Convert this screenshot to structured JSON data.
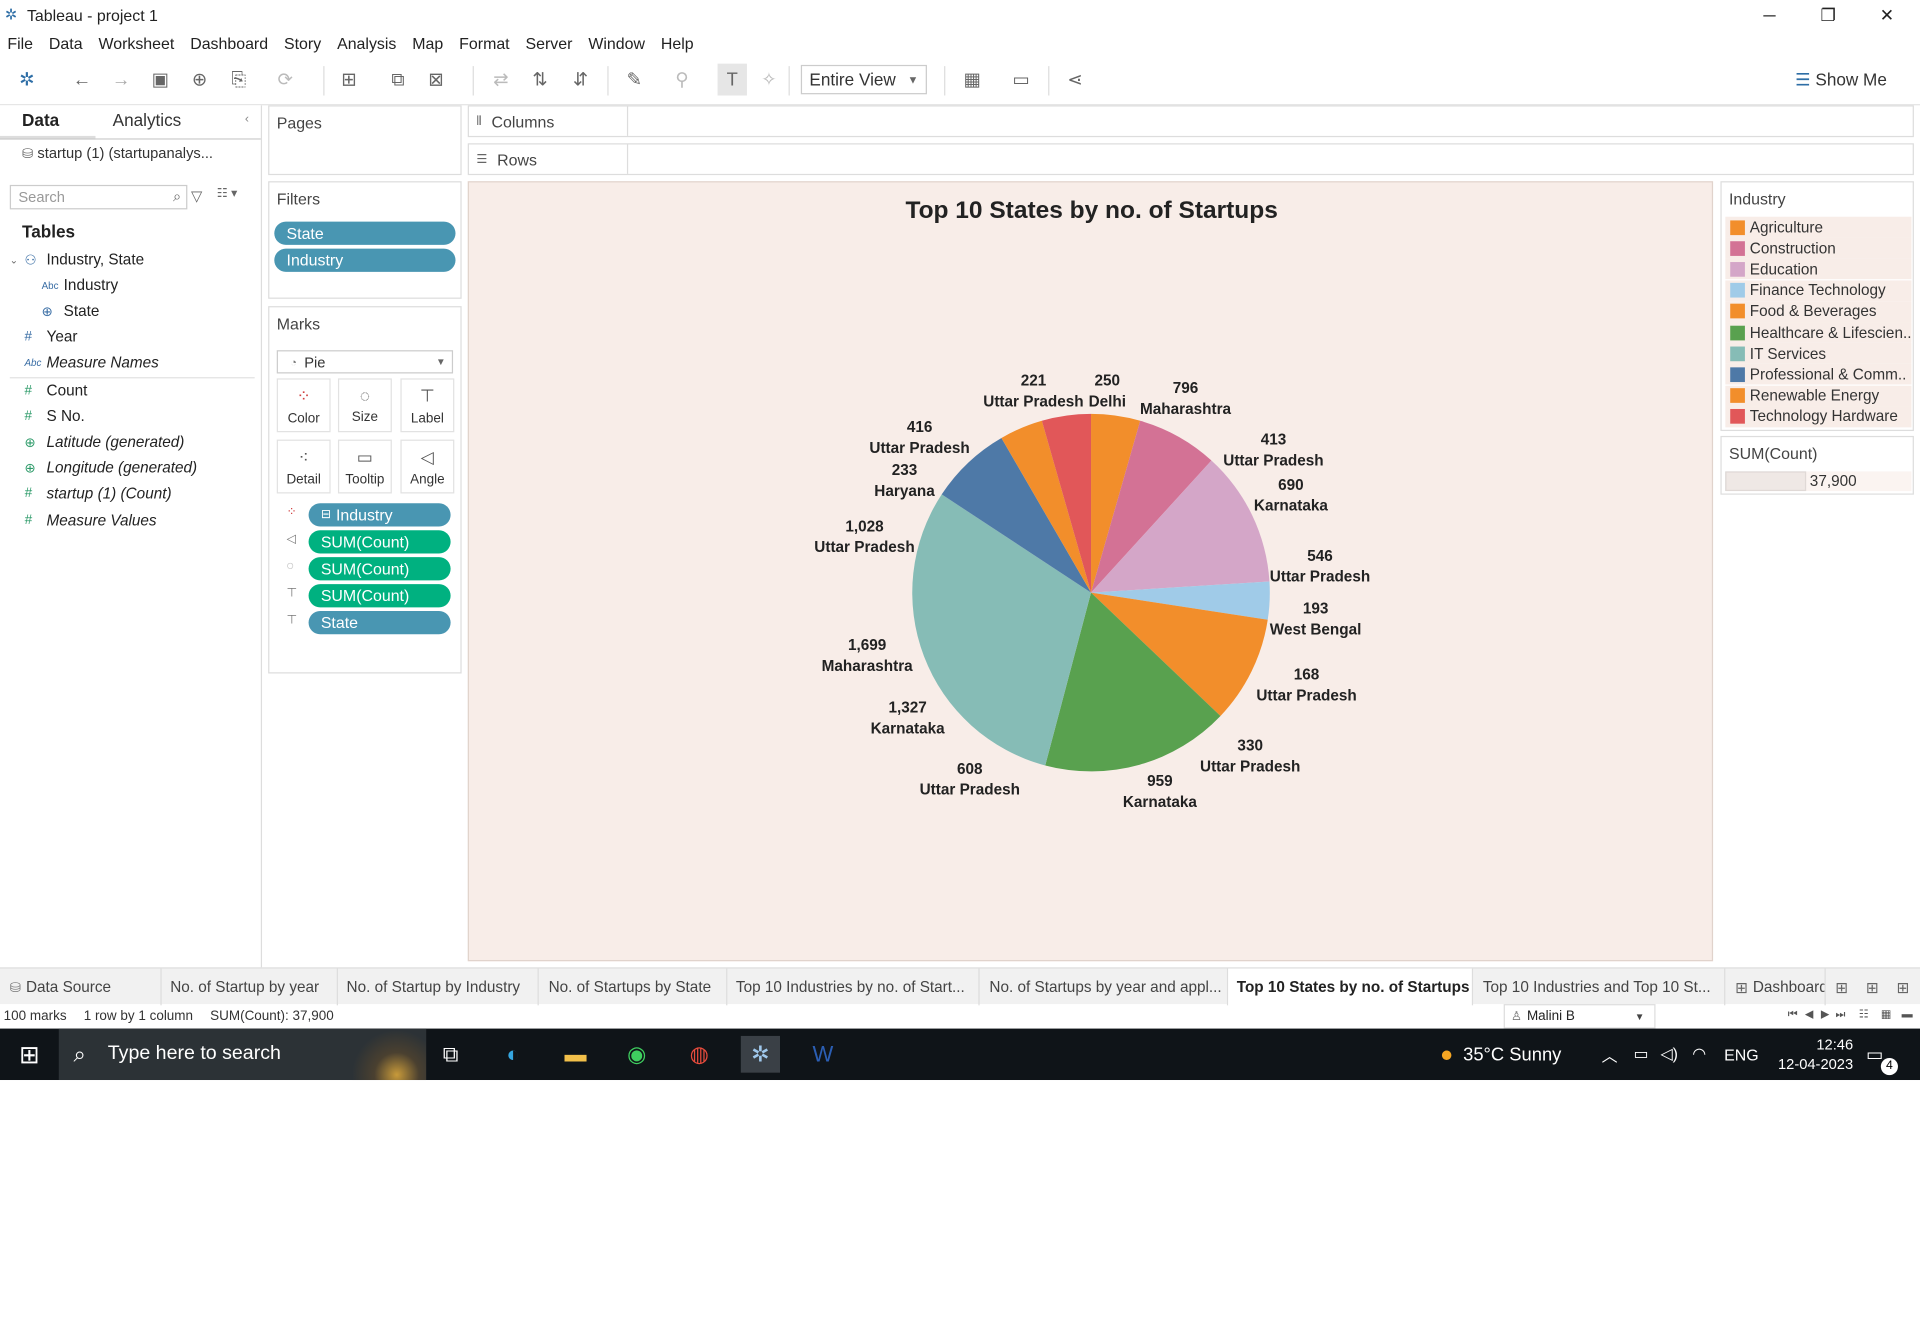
{
  "window": {
    "title": "Tableau - project 1"
  },
  "menu": [
    "File",
    "Data",
    "Worksheet",
    "Dashboard",
    "Story",
    "Analysis",
    "Map",
    "Format",
    "Server",
    "Window",
    "Help"
  ],
  "toolbar": {
    "fit": "Entire View",
    "show_me": "Show Me"
  },
  "data_pane": {
    "tab_data": "Data",
    "tab_analytics": "Analytics",
    "source": "startup (1) (startupanalys...",
    "search_placeholder": "Search",
    "tables_heading": "Tables",
    "fields": [
      {
        "label": "Industry, State",
        "icon": "hierarchy-icon"
      },
      {
        "label": "Industry",
        "icon": "abc-icon"
      },
      {
        "label": "State",
        "icon": "globe-icon"
      },
      {
        "label": "Year",
        "icon": "hash-icon"
      },
      {
        "label": "Measure Names",
        "icon": "abc-icon"
      },
      {
        "label": "Count",
        "icon": "hash-icon"
      },
      {
        "label": "S No.",
        "icon": "hash-icon"
      },
      {
        "label": "Latitude (generated)",
        "icon": "globe-icon"
      },
      {
        "label": "Longitude (generated)",
        "icon": "globe-icon"
      },
      {
        "label": "startup (1) (Count)",
        "icon": "hash-icon"
      },
      {
        "label": "Measure Values",
        "icon": "hash-icon"
      }
    ]
  },
  "pages": {
    "title": "Pages"
  },
  "filters": {
    "title": "Filters",
    "pills": [
      "State",
      "Industry"
    ]
  },
  "marks": {
    "title": "Marks",
    "type": "Pie",
    "buttons": [
      "Color",
      "Size",
      "Label",
      "Detail",
      "Tooltip",
      "Angle"
    ],
    "pills": [
      "Industry",
      "SUM(Count)",
      "SUM(Count)",
      "SUM(Count)",
      "State"
    ]
  },
  "shelves": {
    "columns": "Columns",
    "rows": "Rows"
  },
  "view": {
    "title": "Top 10 States by no. of Startups"
  },
  "chart_data": {
    "type": "pie",
    "title": "Top 10 States by no. of Startups",
    "slices": [
      {
        "industry": "Agriculture",
        "value": 250,
        "state": "Delhi",
        "color": "#f28e2b"
      },
      {
        "industry": "Construction",
        "value": 413,
        "state": "Uttar Pradesh",
        "color": "#d37295"
      },
      {
        "industry": "Education",
        "value": 690,
        "state": "Karnataka",
        "color": "#d4a6c8"
      },
      {
        "industry": "Finance Technology",
        "value": 193,
        "state": "West Bengal",
        "color": "#a0cbe8"
      },
      {
        "industry": "Food & Beverages",
        "value": 546,
        "state": "Uttar Pradesh",
        "color": "#f28e2b"
      },
      {
        "industry": "Healthcare & Lifesciences",
        "value": 959,
        "state": "Karnataka",
        "color": "#59a14f"
      },
      {
        "industry": "IT Services",
        "value": 1699,
        "state": "Maharashtra",
        "color": "#86bcb6"
      },
      {
        "industry": "Professional & Commercial Services",
        "value": 416,
        "state": "Uttar Pradesh",
        "color": "#4e79a7"
      },
      {
        "industry": "Renewable Energy",
        "value": 221,
        "state": "Uttar Pradesh",
        "color": "#f28e2b"
      },
      {
        "industry": "Technology Hardware",
        "value": 250,
        "state": "Delhi",
        "color": "#e15759"
      }
    ],
    "labels": [
      {
        "value": "221",
        "state": "Uttar Pradesh"
      },
      {
        "value": "250",
        "state": "Delhi"
      },
      {
        "value": "796",
        "state": "Maharashtra"
      },
      {
        "value": "413",
        "state": "Uttar Pradesh"
      },
      {
        "value": "690",
        "state": "Karnataka"
      },
      {
        "value": "546",
        "state": "Uttar Pradesh"
      },
      {
        "value": "193",
        "state": "West Bengal"
      },
      {
        "value": "168",
        "state": "Uttar Pradesh"
      },
      {
        "value": "330",
        "state": "Uttar Pradesh"
      },
      {
        "value": "959",
        "state": "Karnataka"
      },
      {
        "value": "608",
        "state": "Uttar Pradesh"
      },
      {
        "value": "1,327",
        "state": "Karnataka"
      },
      {
        "value": "1,699",
        "state": "Maharashtra"
      },
      {
        "value": "1,028",
        "state": "Uttar Pradesh"
      },
      {
        "value": "416",
        "state": "Uttar Pradesh"
      },
      {
        "value": "233",
        "state": "Haryana"
      }
    ]
  },
  "legend": {
    "title": "Industry",
    "items": [
      {
        "label": "Agriculture",
        "color": "#f28e2b"
      },
      {
        "label": "Construction",
        "color": "#d37295"
      },
      {
        "label": "Education",
        "color": "#d4a6c8"
      },
      {
        "label": "Finance Technology",
        "color": "#a0cbe8"
      },
      {
        "label": "Food & Beverages",
        "color": "#f28e2b"
      },
      {
        "label": "Healthcare & Lifescien..",
        "color": "#59a14f"
      },
      {
        "label": "IT Services",
        "color": "#86bcb6"
      },
      {
        "label": "Professional & Comm..",
        "color": "#4e79a7"
      },
      {
        "label": "Renewable Energy",
        "color": "#f28e2b"
      },
      {
        "label": "Technology Hardware",
        "color": "#e15759"
      }
    ]
  },
  "size_legend": {
    "title": "SUM(Count)",
    "value": "37,900"
  },
  "sheet_tabs": [
    "Data Source",
    "No. of Startup by year",
    "No. of Startup by Industry",
    "No. of Startups by State",
    "Top 10 Industries by no. of Start...",
    "No. of Startups by year and appl...",
    "Top 10 States by no. of Startups",
    "Top 10 Industries and Top 10 St...",
    "Dashboard"
  ],
  "status": {
    "marks": "100 marks",
    "rows": "1 row by 1 column",
    "sum": "SUM(Count): 37,900",
    "user": "Malini B"
  },
  "taskbar": {
    "search": "Type here to search",
    "weather": "35°C  Sunny",
    "lang": "ENG",
    "time": "12:46",
    "date": "12-04-2023",
    "notif": "4"
  }
}
